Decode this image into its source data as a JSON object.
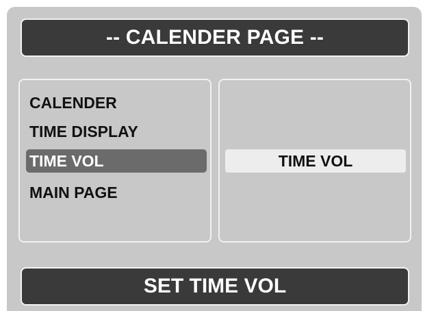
{
  "header": {
    "title": "-- CALENDER PAGE --"
  },
  "menu": {
    "items": [
      {
        "label": "CALENDER",
        "selected": false
      },
      {
        "label": "TIME DISPLAY",
        "selected": false
      },
      {
        "label": "TIME VOL",
        "selected": true
      },
      {
        "label": "MAIN PAGE",
        "selected": false
      }
    ]
  },
  "detail": {
    "value": "TIME VOL"
  },
  "action": {
    "label": "SET TIME VOL"
  },
  "colors": {
    "panel_background": "#c8c8c8",
    "bar_background": "#3a3a3a",
    "selected_background": "#6b6b6b",
    "value_background": "#ededed",
    "border": "#f2f2f2"
  }
}
